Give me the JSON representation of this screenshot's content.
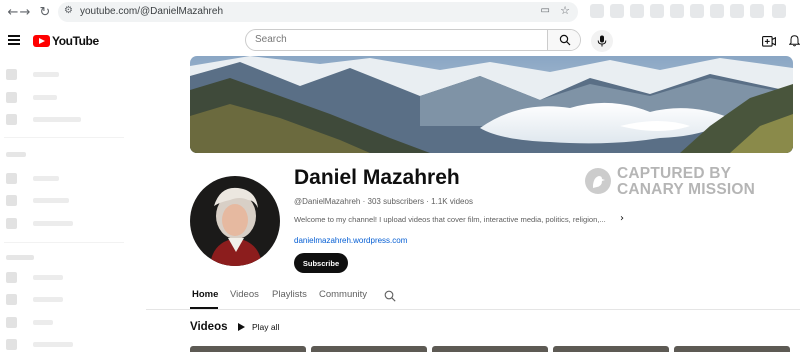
{
  "browser": {
    "url": "youtube.com/@DanielMazahreh",
    "back_icon": "←",
    "forward_icon": "→",
    "reload_icon": "↻"
  },
  "header": {
    "logo_text": "YouTube",
    "search_placeholder": "Search"
  },
  "channel": {
    "name": "Daniel Mazahreh",
    "handle": "@DanielMazahreh",
    "separator": "·",
    "subscribers": "303 subscribers",
    "videos_count": "1.1K videos",
    "description": "Welcome to my channel! I upload videos that cover film, interactive media, politics, religion,...",
    "link": "danielmazahreh.wordpress.com",
    "subscribe_label": "Subscribe"
  },
  "watermark": {
    "line1": "CAPTURED BY",
    "line2": "CANARY MISSION"
  },
  "tabs": [
    {
      "label": "Home",
      "active": true
    },
    {
      "label": "Videos",
      "active": false
    },
    {
      "label": "Playlists",
      "active": false
    },
    {
      "label": "Community",
      "active": false
    }
  ],
  "videos_section": {
    "title": "Videos",
    "play_all_label": "Play all"
  },
  "colors": {
    "brand_red": "#ff0000",
    "link_blue": "#065fd4",
    "subscribe_bg": "#0f0f0f"
  }
}
